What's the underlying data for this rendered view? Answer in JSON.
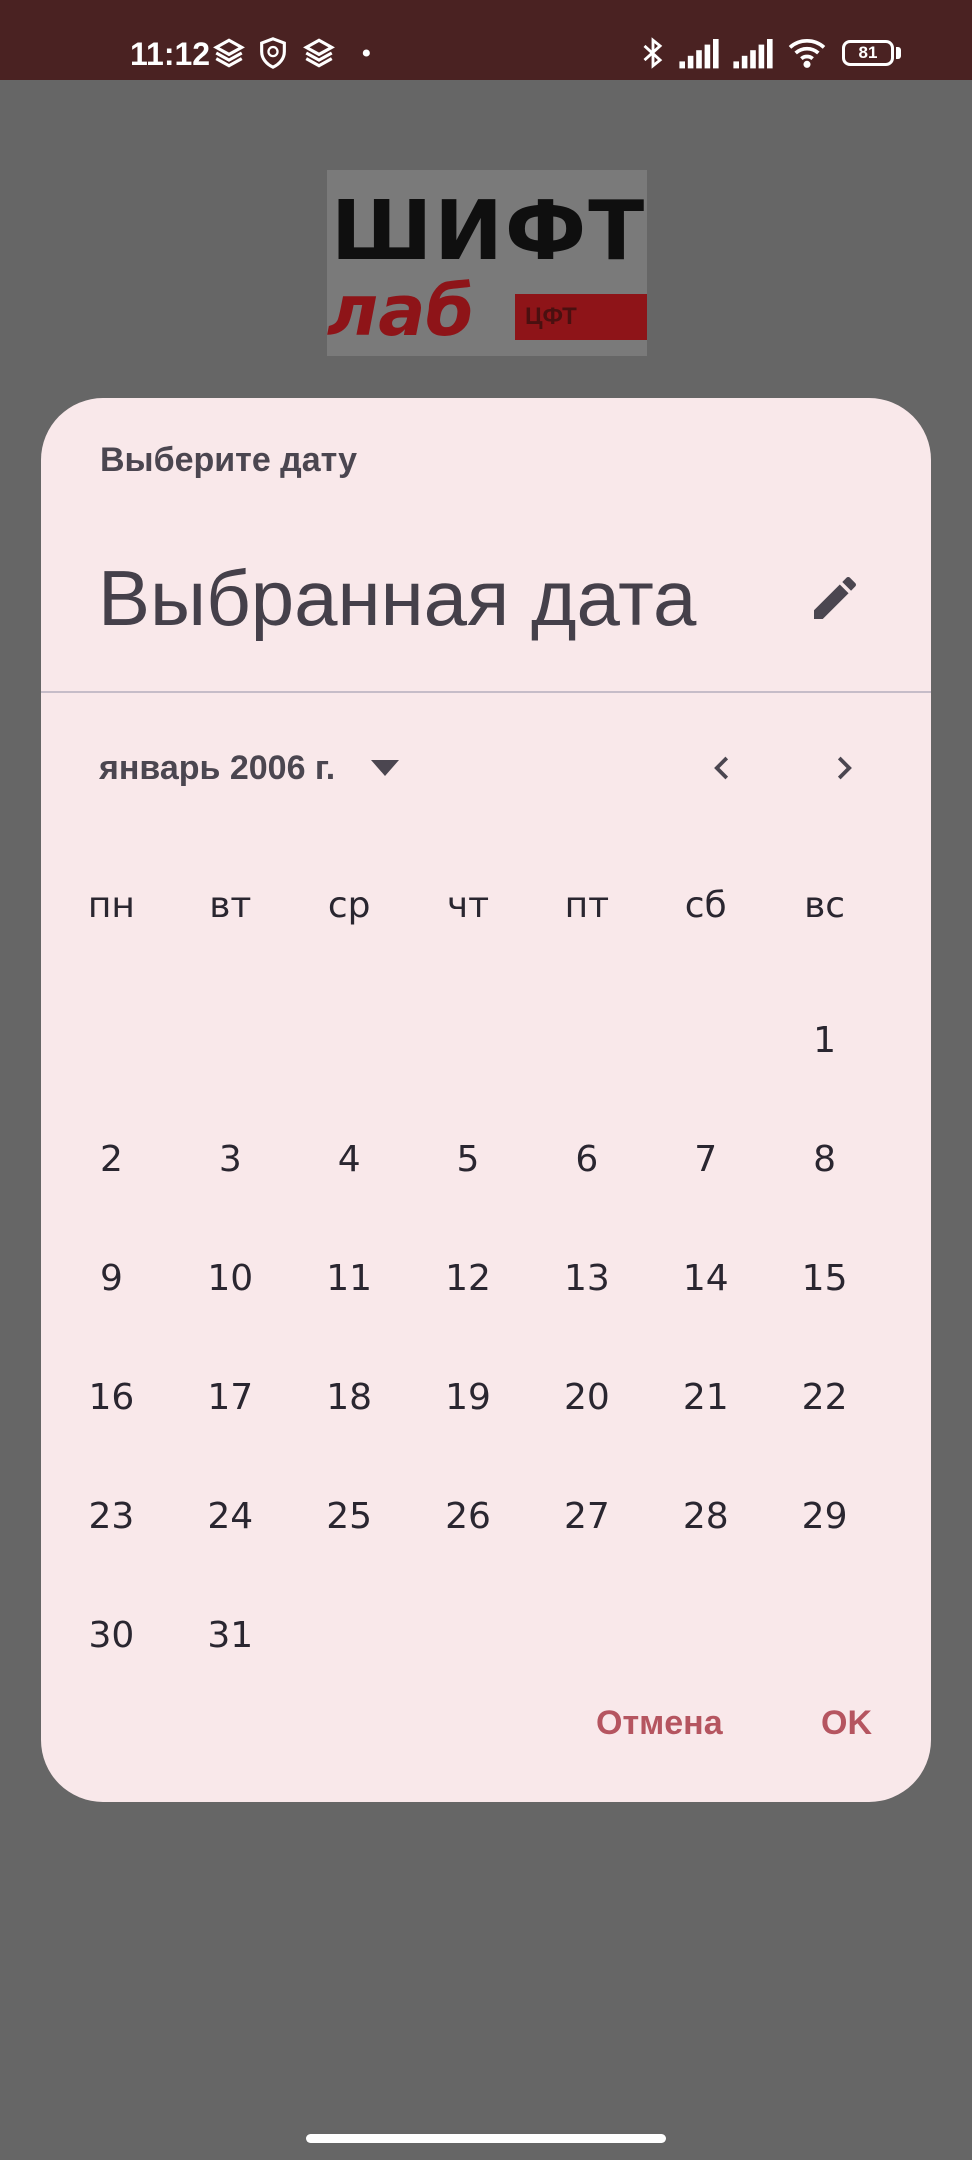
{
  "status_bar": {
    "time": "11:12",
    "battery": "81",
    "icons": [
      "layers-icon",
      "shield-icon",
      "layers-icon",
      "dot-icon",
      "bluetooth-icon",
      "signal-icon",
      "signal-icon",
      "wifi-icon",
      "battery-icon"
    ]
  },
  "logo": {
    "line1": "ШИФТ",
    "line2": "лаб",
    "badge": "ЦФТ"
  },
  "dialog": {
    "header": "Выберите дату",
    "selected_text": "Выбранная дата",
    "edit_icon": "pencil-icon",
    "month_label": "январь 2006 г.",
    "dropdown_icon": "arrow-drop-down-icon",
    "prev_icon": "chevron-left-icon",
    "next_icon": "chevron-right-icon",
    "weekdays": [
      "пн",
      "вт",
      "ср",
      "чт",
      "пт",
      "сб",
      "вс"
    ],
    "weeks": [
      [
        "",
        "",
        "",
        "",
        "",
        "",
        "1"
      ],
      [
        "2",
        "3",
        "4",
        "5",
        "6",
        "7",
        "8"
      ],
      [
        "9",
        "10",
        "11",
        "12",
        "13",
        "14",
        "15"
      ],
      [
        "16",
        "17",
        "18",
        "19",
        "20",
        "21",
        "22"
      ],
      [
        "23",
        "24",
        "25",
        "26",
        "27",
        "28",
        "29"
      ],
      [
        "30",
        "31",
        "",
        "",
        "",
        "",
        ""
      ]
    ],
    "cancel_label": "Отмена",
    "ok_label": "OK"
  },
  "colors": {
    "status_bar": "#4a2222",
    "scrim": "#666666",
    "dialog_bg": "#f9e8ea",
    "accent": "#b55560",
    "text": "#2a2630"
  }
}
